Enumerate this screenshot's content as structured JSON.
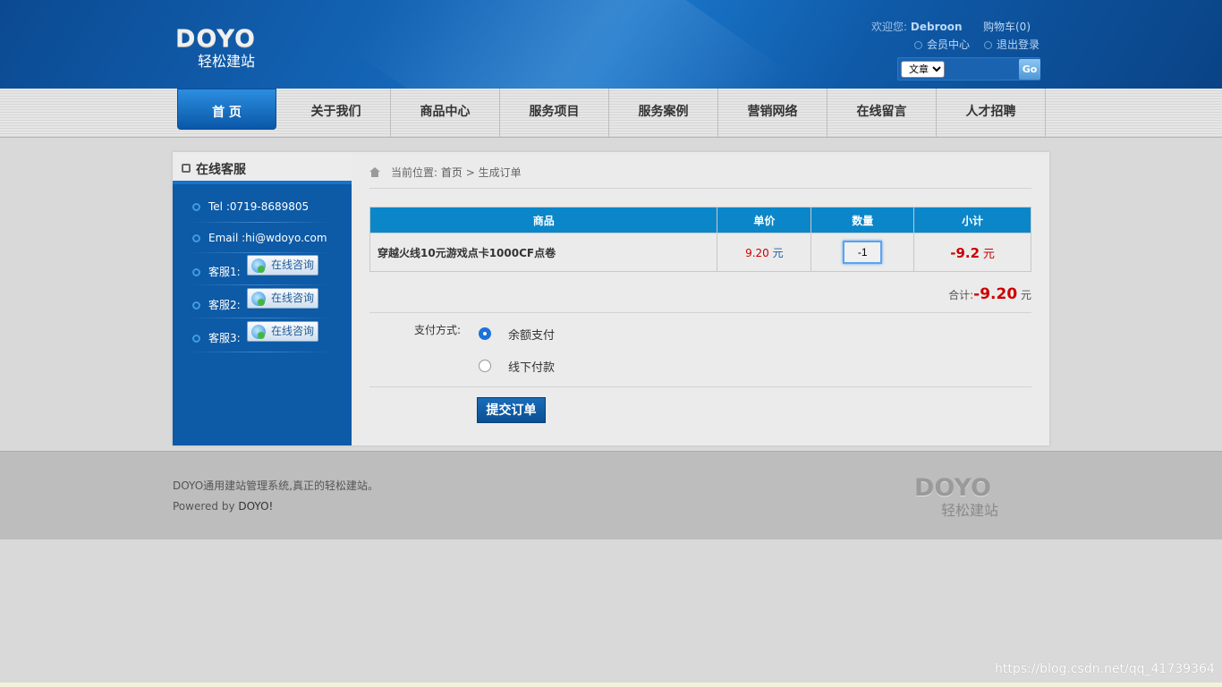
{
  "header": {
    "logo_word": "DOYO",
    "logo_sub": "轻松建站",
    "welcome_label": "欢迎您:",
    "username": "Debroon",
    "cart": "购物车(0)",
    "member_center": "会员中心",
    "logout": "退出登录",
    "search_select": "文章",
    "search_button": "Go"
  },
  "nav": {
    "items": [
      {
        "label": "首 页"
      },
      {
        "label": "关于我们"
      },
      {
        "label": "商品中心"
      },
      {
        "label": "服务项目"
      },
      {
        "label": "服务案例"
      },
      {
        "label": "营销网络"
      },
      {
        "label": "在线留言"
      },
      {
        "label": "人才招聘"
      }
    ]
  },
  "sidebar": {
    "title": "在线客服",
    "tel": "Tel :0719-8689805",
    "email": "Email :hi@wdoyo.com",
    "service1": "客服1:",
    "service2": "客服2:",
    "service3": "客服3:",
    "consult_label": "在线咨询"
  },
  "breadcrumb": {
    "label": "当前位置:",
    "home": "首页",
    "sep": ">",
    "current": "生成订单"
  },
  "cart_table": {
    "headers": [
      "商品",
      "单价",
      "数量",
      "小计"
    ],
    "rows": [
      {
        "name": "穿越火线10元游戏点卡1000CF点卷",
        "price": "9.20",
        "price_unit": "元",
        "qty": "-1",
        "subtotal": "-9.2",
        "subtotal_unit": "元"
      }
    ]
  },
  "total": {
    "label": "合计:",
    "value": "-9.20",
    "unit": "元"
  },
  "payment": {
    "label": "支付方式:",
    "options": [
      "余额支付",
      "线下付款"
    ],
    "selected": "余额支付"
  },
  "submit_label": "提交订单",
  "footer": {
    "line1": "DOYO通用建站管理系统,真正的轻松建站。",
    "line2_prefix": "Powered by ",
    "line2_brand": "DOYO!",
    "logo_word": "DOYO",
    "logo_sub": "轻松建站"
  },
  "watermark": "https://blog.csdn.net/qq_41739364"
}
